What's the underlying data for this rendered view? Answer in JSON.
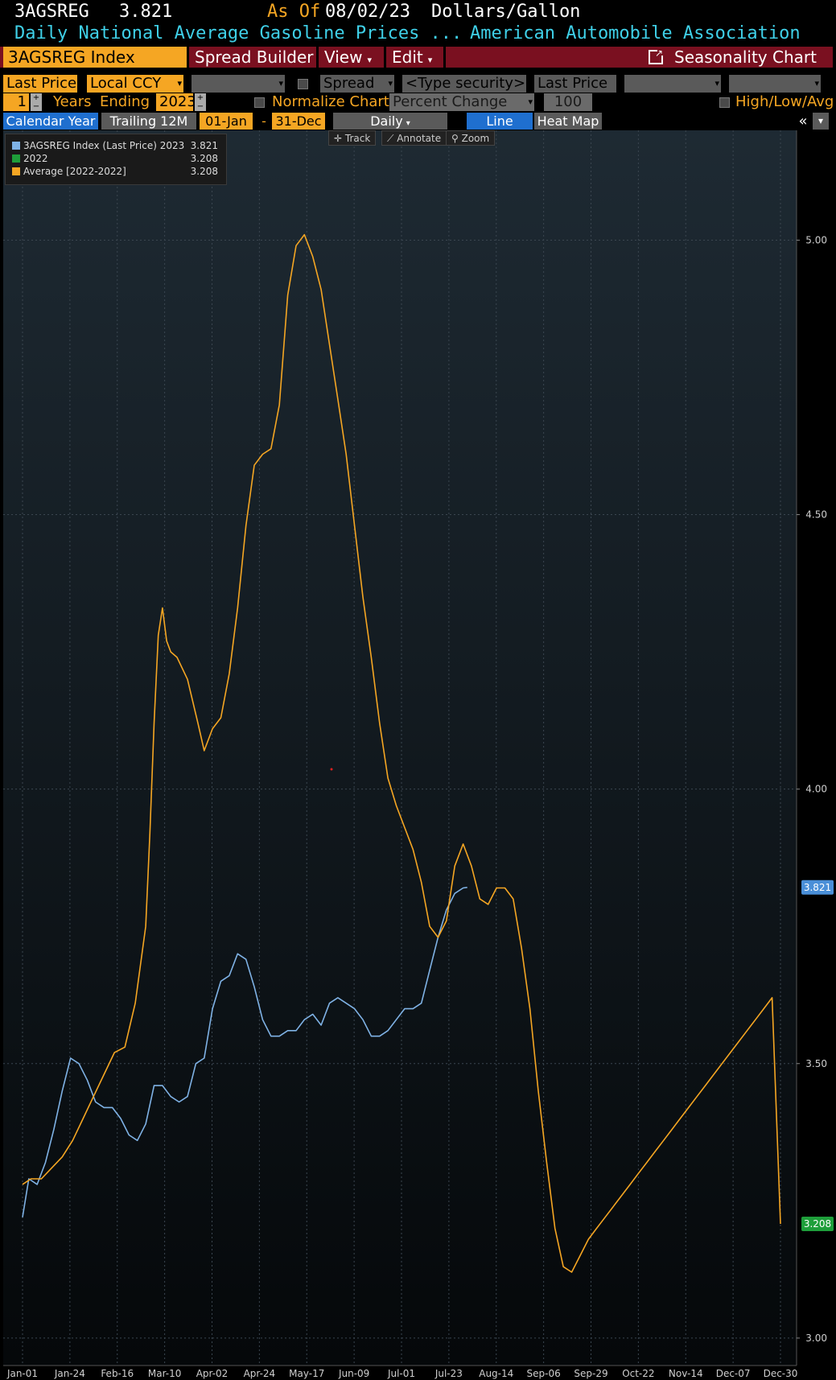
{
  "header": {
    "ticker": "3AGSREG",
    "last_value": "3.821",
    "as_of_label": "As Of",
    "as_of_date": "08/02/23",
    "units": "Dollars/Gallon",
    "description": "Daily National Average Gasoline Prices ...",
    "source": "American Automobile Association"
  },
  "toolbar": {
    "security": "3AGSREG Index",
    "spread_builder": "Spread Builder",
    "view": "View",
    "edit": "Edit",
    "chart_type_title": "Seasonality Chart"
  },
  "controls": {
    "field": "Last Price",
    "currency": "Local CCY",
    "spread_label": "Spread",
    "security_placeholder": "<Type security>",
    "field2": "Last Price",
    "years": "1",
    "years_label": "Years",
    "ending_label": "Ending",
    "ending_year": "2023",
    "normalize_label": "Normalize Chart",
    "normalize_mode": "Percent Change",
    "normalize_base": "100",
    "hla_label": "High/Low/Avg"
  },
  "tabs": {
    "calendar_year": "Calendar Year",
    "trailing": "Trailing 12M",
    "start": "01-Jan",
    "dash": "-",
    "end": "31-Dec",
    "period": "Daily",
    "line": "Line",
    "heatmap": "Heat Map",
    "collapse": "«"
  },
  "chart_tools": {
    "track": "Track",
    "annotate": "Annotate",
    "zoom": "Zoom"
  },
  "legend": [
    {
      "label": "3AGSREG Index (Last Price) 2023",
      "value": "3.821",
      "color": "#7fb2e5"
    },
    {
      "label": "2022",
      "value": "3.208",
      "color": "#1e9e3a"
    },
    {
      "label": "Average  [2022-2022]",
      "value": "3.208",
      "color": "#f5a623"
    }
  ],
  "chart_data": {
    "type": "line",
    "ylim": [
      2.95,
      5.2
    ],
    "y_ticks": [
      "3.00",
      "3.50",
      "4.00",
      "4.50",
      "5.00"
    ],
    "x_tick_labels": [
      "Jan-01",
      "Jan-24",
      "Feb-16",
      "Mar-10",
      "Apr-02",
      "Apr-24",
      "May-17",
      "Jun-09",
      "Jul-01",
      "Jul-23",
      "Aug-14",
      "Sep-06",
      "Sep-29",
      "Oct-22",
      "Nov-14",
      "Dec-07",
      "Dec-30"
    ],
    "last_value_labels": [
      {
        "text": "3.821",
        "bg": "#4a8fd8",
        "value": 3.821
      },
      {
        "text": "3.208",
        "bg": "#1e9e3a",
        "value": 3.208
      }
    ],
    "series": [
      {
        "name": "3AGSREG Index (Last Price) 2023",
        "color": "#7fb2e5",
        "x": [
          1,
          4,
          8,
          12,
          16,
          20,
          24,
          28,
          32,
          36,
          40,
          44,
          48,
          52,
          56,
          60,
          64,
          68,
          72,
          76,
          80,
          84,
          88,
          92,
          96,
          100,
          104,
          108,
          112,
          116,
          120,
          124,
          128,
          132,
          136,
          140,
          144,
          148,
          152,
          156,
          160,
          164,
          168,
          172,
          176,
          180,
          184,
          188,
          192,
          196,
          200,
          204,
          208,
          212,
          214
        ],
        "values": [
          3.22,
          3.29,
          3.28,
          3.32,
          3.38,
          3.45,
          3.51,
          3.5,
          3.47,
          3.43,
          3.42,
          3.42,
          3.4,
          3.37,
          3.36,
          3.39,
          3.46,
          3.46,
          3.44,
          3.43,
          3.44,
          3.5,
          3.51,
          3.6,
          3.65,
          3.66,
          3.7,
          3.69,
          3.64,
          3.58,
          3.55,
          3.55,
          3.56,
          3.56,
          3.58,
          3.59,
          3.57,
          3.61,
          3.62,
          3.61,
          3.6,
          3.58,
          3.55,
          3.55,
          3.56,
          3.58,
          3.6,
          3.6,
          3.61,
          3.67,
          3.73,
          3.78,
          3.81,
          3.82,
          3.821
        ]
      },
      {
        "name": "Average  [2022-2022]",
        "color": "#f5a623",
        "x": [
          1,
          5,
          10,
          15,
          20,
          25,
          30,
          35,
          40,
          45,
          50,
          55,
          60,
          62,
          64,
          66,
          68,
          70,
          72,
          75,
          80,
          85,
          88,
          92,
          96,
          100,
          104,
          108,
          112,
          116,
          120,
          124,
          128,
          132,
          136,
          140,
          144,
          148,
          152,
          156,
          160,
          164,
          168,
          172,
          176,
          180,
          184,
          188,
          192,
          196,
          200,
          204,
          208,
          212,
          216,
          220,
          224,
          228,
          232,
          236,
          240,
          244,
          248,
          252,
          256,
          260,
          264,
          268,
          272,
          276,
          280,
          284,
          288,
          292,
          296,
          300,
          304,
          308,
          312,
          316,
          320,
          324,
          328,
          332,
          336,
          340,
          344,
          348,
          352,
          356,
          360,
          364
        ],
        "values": [
          3.28,
          3.29,
          3.29,
          3.31,
          3.33,
          3.36,
          3.4,
          3.44,
          3.48,
          3.52,
          3.53,
          3.61,
          3.75,
          3.92,
          4.12,
          4.28,
          4.33,
          4.27,
          4.25,
          4.24,
          4.2,
          4.12,
          4.07,
          4.11,
          4.13,
          4.21,
          4.33,
          4.48,
          4.59,
          4.61,
          4.62,
          4.7,
          4.9,
          4.99,
          5.01,
          4.97,
          4.91,
          4.81,
          4.71,
          4.61,
          4.48,
          4.35,
          4.24,
          4.12,
          4.02,
          3.97,
          3.93,
          3.89,
          3.83,
          3.75,
          3.73,
          3.76,
          3.86,
          3.9,
          3.86,
          3.8,
          3.79,
          3.82,
          3.82,
          3.8,
          3.71,
          3.6,
          3.45,
          3.32,
          3.2,
          3.13,
          3.12,
          3.15,
          3.18,
          3.2,
          3.22,
          3.24,
          3.26,
          3.28,
          3.3,
          3.32,
          3.34,
          3.36,
          3.38,
          3.4,
          3.42,
          3.44,
          3.46,
          3.48,
          3.5,
          3.52,
          3.54,
          3.56,
          3.58,
          3.6,
          3.62,
          3.208
        ]
      }
    ]
  }
}
